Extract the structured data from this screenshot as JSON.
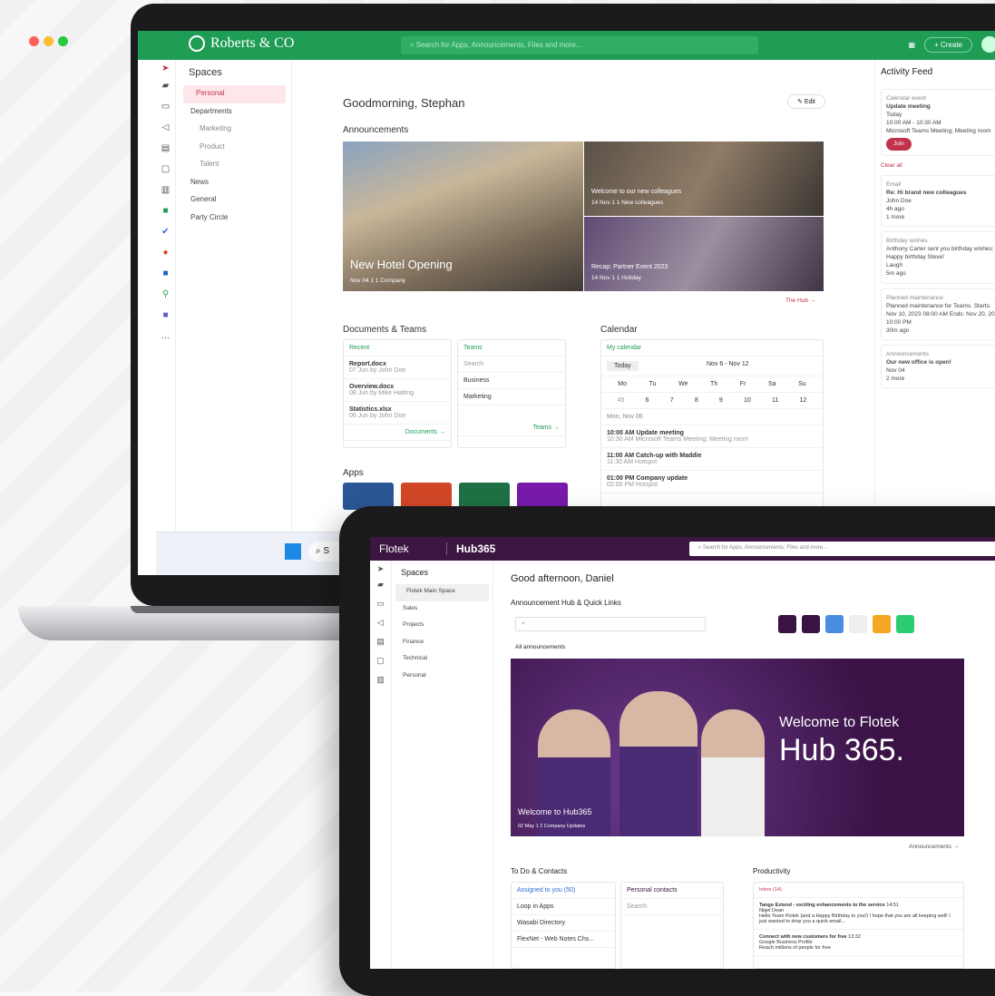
{
  "laptop": {
    "app_logo": "Roberts & CO",
    "search_placeholder": "Search for Apps, Announcements, Files and more...",
    "create_label": "+ Create",
    "spaces": {
      "title": "Spaces",
      "items": [
        "Personal",
        "Departments",
        "Marketing",
        "Product",
        "Talent",
        "News",
        "General",
        "Party Circle"
      ]
    },
    "greeting": "Goodmorning, Stephan",
    "edit_label": "Edit",
    "announcements": {
      "title": "Announcements",
      "main_caption": "New Hotel Opening",
      "main_meta": "Nov 04  1  1  Company",
      "item1": "Welcome to our new colleagues",
      "item1_meta": "14 Nov  1  1  New colleagues",
      "item2": "Recap: Partner Event 2023",
      "item2_meta": "14 Nov  1  1  Holiday",
      "link": "The Hub →"
    },
    "documents": {
      "title": "Documents & Teams",
      "recent_label": "Recent",
      "files": [
        {
          "name": "Report.docx",
          "meta": "07 Jun by John Doe"
        },
        {
          "name": "Overview.docx",
          "meta": "08 Jun by Mike Hatting"
        },
        {
          "name": "Statistics.xlsx",
          "meta": "06 Jun by John Doe"
        }
      ],
      "documents_link": "Documents →",
      "teams_label": "Teams",
      "teams_search": "Search",
      "teams": [
        "Business",
        "Marketing"
      ],
      "teams_link": "Teams →"
    },
    "apps_title": "Apps",
    "calendar": {
      "title": "Calendar",
      "my_calendar": "My calendar",
      "today": "Today",
      "range": "Nov 6 - Nov 12",
      "days": [
        "Mo",
        "Tu",
        "We",
        "Th",
        "Fr",
        "Sa",
        "Su"
      ],
      "week": "45",
      "dates": [
        "6",
        "7",
        "8",
        "9",
        "10",
        "11",
        "12"
      ],
      "day_label": "Mon, Nov 06",
      "events": [
        {
          "time": "10:00 AM",
          "end": "10:30 AM",
          "title": "Update meeting",
          "sub": "Microsoft Teams Meeting; Meeting room"
        },
        {
          "time": "11:00 AM",
          "end": "11:30 AM",
          "title": "Catch-up with Maddie",
          "sub": "Hotspot"
        },
        {
          "time": "01:00 PM",
          "end": "02:00 PM",
          "title": "Company update",
          "sub": "Hotspot"
        }
      ]
    },
    "feed": {
      "title": "Activity Feed",
      "c1_type": "Calendar event",
      "c1_title": "Update meeting",
      "c1_date": "Today",
      "c1_time": "10:00 AM - 10:30 AM",
      "c1_where": "Microsoft Teams Meeting; Meeting room",
      "join": "Join",
      "clear": "Clear all",
      "c2_type": "Email",
      "c2_title": "Re: Hi brand new colleagues",
      "c2_from": "John Doe",
      "c2_ago": "4h ago",
      "c2_more": "1 more",
      "c3_type": "Birthday wishes",
      "c3_text": "Anthony Carter sent you birthday wishes: Happy birthday Steve!",
      "c3_laugh": "Laugh",
      "c3_ago": "5m ago",
      "c4_type": "Planned maintenance",
      "c4_text": "Planned maintenance for Teams. Starts: Nov 10, 2023 08:00 AM Ends: Nov 20, 2023 10:00 PM",
      "c4_ago": "30m ago",
      "c5_type": "Announcements",
      "c5_text": "Our new office is open!",
      "c5_date": "Nov 04",
      "c5_more": "2 more"
    }
  },
  "tablet": {
    "logo": "Flotek",
    "hub": "Hub365",
    "search_placeholder": "Search for Apps, Announcements, Files and more...",
    "spaces": {
      "title": "Spaces",
      "items": [
        "Flotek Main Space",
        "Sales",
        "Projects",
        "Finance",
        "Technical",
        "Personal"
      ]
    },
    "greeting": "Good afternoon, Daniel",
    "hub_title": "Announcement Hub & Quick Links",
    "filter": "All announcements",
    "hero_line1": "Welcome to Flotek",
    "hero_line2": "Hub 365.",
    "hero_caption": "Welcome to Hub365",
    "hero_meta": "02 May  1  2  Company Updates",
    "announcements_link": "Announcements →",
    "todo": {
      "title": "To Do & Contacts",
      "assigned": "Assigned to you (50)",
      "contacts": "Personal contacts",
      "search": "Search",
      "tasks": [
        "Loop in Apps",
        "Wasabi Directory",
        "FlexNet - Web Notes Chs..."
      ]
    },
    "productivity": {
      "title": "Productivity",
      "inbox": "Inbox (14)",
      "mails": [
        {
          "from": "Tango Extend - exciting enhancements to the service",
          "sender": "Nigel Dean",
          "time": "14:51",
          "body": "Hello Team Flotek (and a Happy Birthday to you!) I hope that you are all keeping well! I just wanted to drop you a quick email..."
        },
        {
          "from": "Connect with new customers for free",
          "sender": "Google Business Profile",
          "time": "13:32",
          "body": "Reach millions of people for free"
        }
      ]
    }
  },
  "taskbar": {
    "search": "S"
  }
}
